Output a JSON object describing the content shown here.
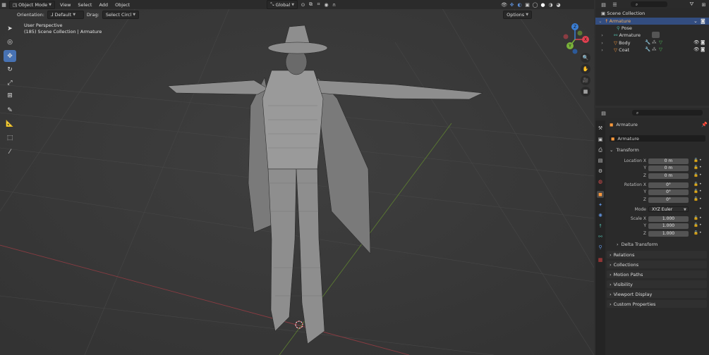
{
  "viewport": {
    "header": {
      "mode": "Object Mode",
      "menus": [
        "View",
        "Select",
        "Add",
        "Object"
      ],
      "transform_orientation": "Global",
      "options_label": "Options"
    },
    "tool_header": {
      "orientation_label": "Orientation:",
      "orientation_value": "Default",
      "drag_label": "Drag:",
      "drag_value": "Select Circl"
    },
    "info": {
      "perspective": "User Perspective",
      "collection": "(185) Scene Collection | Armature"
    },
    "gizmo_axes": [
      "X",
      "Y",
      "Z"
    ],
    "colors": {
      "x_axis": "#e04050",
      "y_axis": "#7ab33a",
      "z_axis": "#3b7fd6",
      "active_tool": "#4772b3"
    }
  },
  "outliner": {
    "items": [
      {
        "label": "Scene Collection"
      },
      {
        "label": "Armature"
      },
      {
        "label": "Pose"
      },
      {
        "label": "Armature"
      },
      {
        "label": "Body"
      },
      {
        "label": "Coat"
      }
    ]
  },
  "properties": {
    "object_name": "Armature",
    "name_field": "Armature",
    "transform_title": "Transform",
    "location": {
      "label": "Location X",
      "x": "0 m",
      "y": "0 m",
      "z": "0 m"
    },
    "rotation": {
      "label": "Rotation X",
      "x": "0°",
      "y": "0°",
      "z": "0°"
    },
    "mode": {
      "label": "Mode",
      "value": "XYZ Euler"
    },
    "scale": {
      "label": "Scale X",
      "x": "1.000",
      "y": "1.000",
      "z": "1.000"
    },
    "axis_labels": {
      "y": "Y",
      "z": "Z"
    },
    "sections": [
      "Delta Transform",
      "Relations",
      "Collections",
      "Motion Paths",
      "Visibility",
      "Viewport Display",
      "Custom Properties"
    ]
  }
}
